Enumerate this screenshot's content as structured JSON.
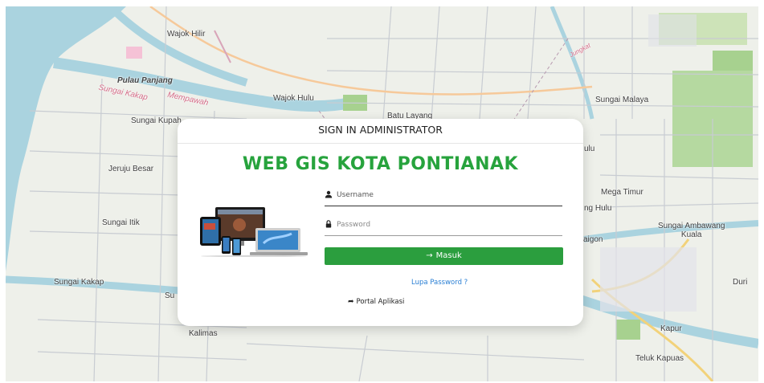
{
  "map": {
    "labels": {
      "wajok_hilir": "Wajok Hilir",
      "pulau_panjang": "Pulau Panjang",
      "sungai_kakap_river": "Sungai Kakap",
      "mempawah": "Mempawah",
      "sungai_kupah": "Sungai Kupah",
      "wajok_hulu": "Wajok Hulu",
      "batu_layang": "Batu Layang",
      "sungai_malaya": "Sungai Malaya",
      "jeruju_besar": "Jeruju Besar",
      "mega_timur": "Mega Timur",
      "ng_hulu": "ng Hulu",
      "sungai_ambawang_kuala": "Sungai Ambawang\nKuala",
      "sungai_itik": "Sungai Itik",
      "aigon": "aigon",
      "sungai_kakap": "Sungai Kakap",
      "suri": "Su",
      "duri": "Duri",
      "kalimas": "Kalimas",
      "kapur": "Kapur",
      "teluk_kapuas": "Teluk Kapuas",
      "jungkat": "Jungkat",
      "ulu": "ulu"
    }
  },
  "login": {
    "header": "SIGN IN ADMINISTRATOR",
    "title": "WEB GIS KOTA PONTIANAK",
    "username_placeholder": "Username",
    "password_placeholder": "Password",
    "submit_label": "Masuk",
    "forgot_label": "Lupa Password ?",
    "portal_label": "Portal Aplikasi"
  },
  "colors": {
    "brand_green": "#27a33d",
    "button_green": "#2b9e3e",
    "link_blue": "#2a7fd4"
  }
}
